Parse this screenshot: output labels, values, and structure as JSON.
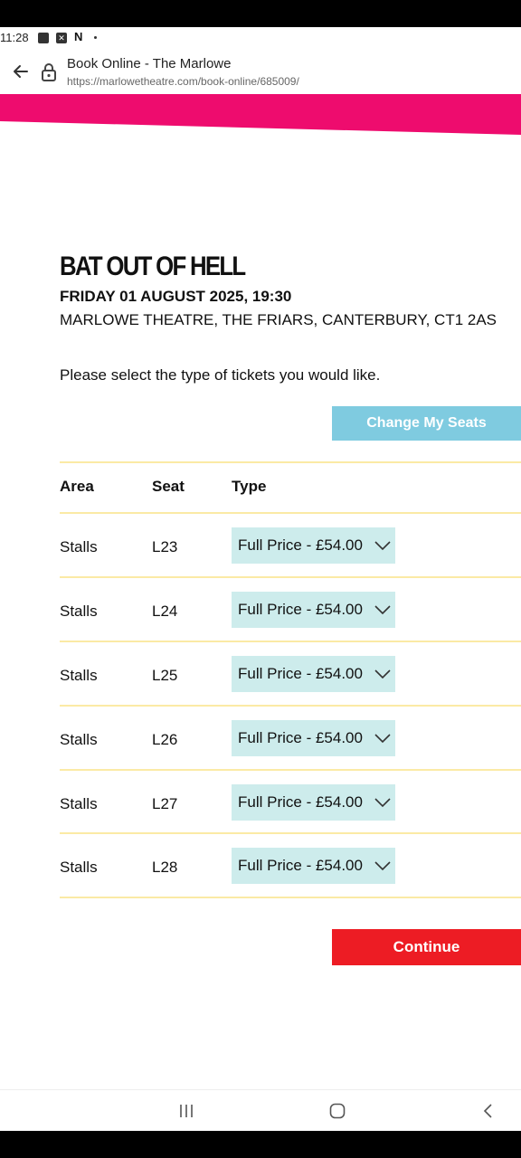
{
  "status_bar": {
    "time": "11:28",
    "notif_letter": "N"
  },
  "browser": {
    "title": "Book Online - The Marlowe",
    "url": "https://marlowetheatre.com/book-online/685009/"
  },
  "colors": {
    "banner": "#ee0c6e",
    "change_seats_bg": "#7fcbe0",
    "select_bg": "#cdecec",
    "continue_bg": "#ed1c24",
    "divider": "#fbeaa5"
  },
  "event": {
    "title": "BAT OUT OF HELL",
    "date": "FRIDAY 01 AUGUST 2025, 19:30",
    "venue": "MARLOWE THEATRE, THE FRIARS, CANTERBURY, CT1 2AS"
  },
  "instructions": "Please select the type of tickets you would like.",
  "change_seats_label": "Change My Seats",
  "table": {
    "headers": [
      "Area",
      "Seat",
      "Type"
    ],
    "rows": [
      {
        "area": "Stalls",
        "seat": "L23",
        "type": "Full Price - £54.00"
      },
      {
        "area": "Stalls",
        "seat": "L24",
        "type": "Full Price - £54.00"
      },
      {
        "area": "Stalls",
        "seat": "L25",
        "type": "Full Price - £54.00"
      },
      {
        "area": "Stalls",
        "seat": "L26",
        "type": "Full Price - £54.00"
      },
      {
        "area": "Stalls",
        "seat": "L27",
        "type": "Full Price - £54.00"
      },
      {
        "area": "Stalls",
        "seat": "L28",
        "type": "Full Price - £54.00"
      }
    ]
  },
  "continue_label": "Continue",
  "nav": {
    "icons": [
      "recents-icon",
      "home-icon",
      "back-icon"
    ]
  }
}
